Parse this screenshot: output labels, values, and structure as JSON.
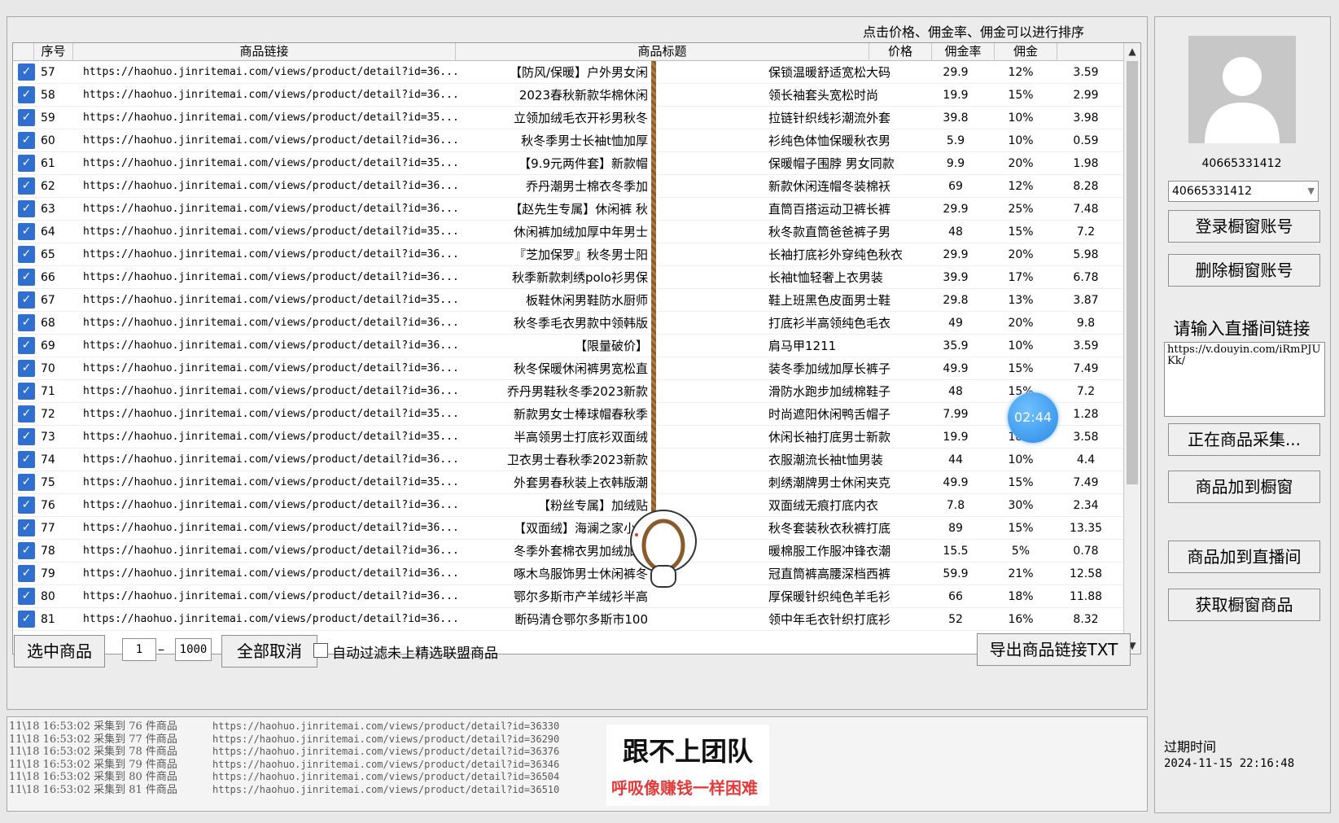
{
  "hint": "点击价格、佣金率、佣金可以进行排序",
  "columns": {
    "index": "序号",
    "link": "商品链接",
    "title": "商品标题",
    "price": "价格",
    "rate": "佣金率",
    "commission": "佣金"
  },
  "rows": [
    {
      "idx": "57",
      "link": "https://haohuo.jinritemai.com/views/product/detail?id=36...",
      "t1": "【防风/保暖】户外男女闲",
      "t2": "保锁温暖舒适宽松大码",
      "price": "29.9",
      "rate": "12%",
      "comm": "3.59"
    },
    {
      "idx": "58",
      "link": "https://haohuo.jinritemai.com/views/product/detail?id=36...",
      "t1": "2023春秋新款华棉休闲",
      "t2": "领长袖套头宽松时尚",
      "price": "19.9",
      "rate": "15%",
      "comm": "2.99"
    },
    {
      "idx": "59",
      "link": "https://haohuo.jinritemai.com/views/product/detail?id=35...",
      "t1": "立领加绒毛衣开衫男秋冬",
      "t2": "拉链针织线衫潮流外套",
      "price": "39.8",
      "rate": "10%",
      "comm": "3.98"
    },
    {
      "idx": "60",
      "link": "https://haohuo.jinritemai.com/views/product/detail?id=36...",
      "t1": "秋冬季男士长袖t恤加厚",
      "t2": "衫纯色体恤保暖秋衣男",
      "price": "5.9",
      "rate": "10%",
      "comm": "0.59"
    },
    {
      "idx": "61",
      "link": "https://haohuo.jinritemai.com/views/product/detail?id=35...",
      "t1": "【9.9元两件套】新款帽",
      "t2": "保暖帽子围脖 男女同款",
      "price": "9.9",
      "rate": "20%",
      "comm": "1.98"
    },
    {
      "idx": "62",
      "link": "https://haohuo.jinritemai.com/views/product/detail?id=36...",
      "t1": "乔丹潮男士棉衣冬季加",
      "t2": "新款休闲连帽冬装棉袄",
      "price": "69",
      "rate": "12%",
      "comm": "8.28"
    },
    {
      "idx": "63",
      "link": "https://haohuo.jinritemai.com/views/product/detail?id=36...",
      "t1": "【赵先生专属】休闲裤 秋",
      "t2": "直筒百搭运动卫裤长裤",
      "price": "29.9",
      "rate": "25%",
      "comm": "7.48"
    },
    {
      "idx": "64",
      "link": "https://haohuo.jinritemai.com/views/product/detail?id=35...",
      "t1": "休闲裤加绒加厚中年男士",
      "t2": "秋冬款直筒爸爸裤子男",
      "price": "48",
      "rate": "15%",
      "comm": "7.2"
    },
    {
      "idx": "65",
      "link": "https://haohuo.jinritemai.com/views/product/detail?id=36...",
      "t1": "『芝加保罗』秋冬男士阳",
      "t2": "长袖打底衫外穿纯色秋衣",
      "price": "29.9",
      "rate": "20%",
      "comm": "5.98"
    },
    {
      "idx": "66",
      "link": "https://haohuo.jinritemai.com/views/product/detail?id=36...",
      "t1": "秋季新款刺绣polo衫男保",
      "t2": "长袖t恤轻奢上衣男装",
      "price": "39.9",
      "rate": "17%",
      "comm": "6.78"
    },
    {
      "idx": "67",
      "link": "https://haohuo.jinritemai.com/views/product/detail?id=35...",
      "t1": "板鞋休闲男鞋防水厨师",
      "t2": "鞋上班黑色皮面男士鞋",
      "price": "29.8",
      "rate": "13%",
      "comm": "3.87"
    },
    {
      "idx": "68",
      "link": "https://haohuo.jinritemai.com/views/product/detail?id=36...",
      "t1": "秋冬季毛衣男款中领韩版",
      "t2": "打底衫半高领纯色毛衣",
      "price": "49",
      "rate": "20%",
      "comm": "9.8"
    },
    {
      "idx": "69",
      "link": "https://haohuo.jinritemai.com/views/product/detail?id=36...",
      "t1": "【限量破价】",
      "t2": "肩马甲1211",
      "price": "35.9",
      "rate": "10%",
      "comm": "3.59"
    },
    {
      "idx": "70",
      "link": "https://haohuo.jinritemai.com/views/product/detail?id=36...",
      "t1": "秋冬保暖休闲裤男宽松直",
      "t2": "装冬季加绒加厚长裤子",
      "price": "49.9",
      "rate": "15%",
      "comm": "7.49"
    },
    {
      "idx": "71",
      "link": "https://haohuo.jinritemai.com/views/product/detail?id=36...",
      "t1": "乔丹男鞋秋冬季2023新款",
      "t2": "滑防水跑步加绒棉鞋子",
      "price": "48",
      "rate": "15%",
      "comm": "7.2"
    },
    {
      "idx": "72",
      "link": "https://haohuo.jinritemai.com/views/product/detail?id=35...",
      "t1": "新款男女士棒球帽春秋季",
      "t2": "时尚遮阳休闲鸭舌帽子",
      "price": "7.99",
      "rate": "16%",
      "comm": "1.28"
    },
    {
      "idx": "73",
      "link": "https://haohuo.jinritemai.com/views/product/detail?id=35...",
      "t1": "半高领男士打底衫双面绒",
      "t2": "休闲长袖打底男士新款",
      "price": "19.9",
      "rate": "18%",
      "comm": "3.58"
    },
    {
      "idx": "74",
      "link": "https://haohuo.jinritemai.com/views/product/detail?id=36...",
      "t1": "卫衣男士春秋季2023新款",
      "t2": "衣服潮流长袖t恤男装",
      "price": "44",
      "rate": "10%",
      "comm": "4.4"
    },
    {
      "idx": "75",
      "link": "https://haohuo.jinritemai.com/views/product/detail?id=35...",
      "t1": "外套男春秋装上衣韩版潮",
      "t2": "刺绣潮牌男士休闲夹克",
      "price": "49.9",
      "rate": "15%",
      "comm": "7.49"
    },
    {
      "idx": "76",
      "link": "https://haohuo.jinritemai.com/views/product/detail?id=36...",
      "t1": "【粉丝专属】加绒贴",
      "t2": "双面绒无痕打底内衣",
      "price": "7.8",
      "rate": "30%",
      "comm": "2.34"
    },
    {
      "idx": "77",
      "link": "https://haohuo.jinritemai.com/views/product/detail?id=36...",
      "t1": "【双面绒】海澜之家小火",
      "t2": "秋冬套装秋衣秋裤打底",
      "price": "89",
      "rate": "15%",
      "comm": "13.35"
    },
    {
      "idx": "78",
      "link": "https://haohuo.jinritemai.com/views/product/detail?id=36...",
      "t1": "冬季外套棉衣男加绒加厚",
      "t2": "暖棉服工作服冲锋衣潮",
      "price": "15.5",
      "rate": "5%",
      "comm": "0.78"
    },
    {
      "idx": "79",
      "link": "https://haohuo.jinritemai.com/views/product/detail?id=36...",
      "t1": "啄木鸟服饰男士休闲裤冬",
      "t2": "冠直筒裤高腰深档西裤",
      "price": "59.9",
      "rate": "21%",
      "comm": "12.58"
    },
    {
      "idx": "80",
      "link": "https://haohuo.jinritemai.com/views/product/detail?id=36...",
      "t1": "鄂尔多斯市产羊绒衫半高",
      "t2": "厚保暖针织纯色羊毛衫",
      "price": "66",
      "rate": "18%",
      "comm": "11.88"
    },
    {
      "idx": "81",
      "link": "https://haohuo.jinritemai.com/views/product/detail?id=36...",
      "t1": "断码清仓鄂尔多斯市100",
      "t2": "领中年毛衣针织打底衫",
      "price": "52",
      "rate": "16%",
      "comm": "8.32"
    }
  ],
  "controls": {
    "select_products": "选中商品",
    "range_from": "1",
    "range_to": "1000",
    "range_sep": "–",
    "cancel_all": "全部取消",
    "auto_filter": "自动过滤未上精选联盟商品",
    "export_txt": "导出商品链接TXT"
  },
  "log": [
    {
      "text": "11\\18 16:53:02 采集到 76 件商品",
      "url": "https://haohuo.jinritemai.com/views/product/detail?id=36330"
    },
    {
      "text": "11\\18 16:53:02 采集到 77 件商品",
      "url": "https://haohuo.jinritemai.com/views/product/detail?id=36290"
    },
    {
      "text": "11\\18 16:53:02 采集到 78 件商品",
      "url": "https://haohuo.jinritemai.com/views/product/detail?id=36376"
    },
    {
      "text": "11\\18 16:53:02 采集到 79 件商品",
      "url": "https://haohuo.jinritemai.com/views/product/detail?id=36346"
    },
    {
      "text": "11\\18 16:53:02 采集到 80 件商品",
      "url": "https://haohuo.jinritemai.com/views/product/detail?id=36504"
    },
    {
      "text": "11\\18 16:53:02 采集到 81 件商品",
      "url": "https://haohuo.jinritemai.com/views/product/detail?id=36510"
    }
  ],
  "overlay": {
    "line1": "跟不上团队",
    "line2": "呼吸像赚钱一样困难",
    "timer": "02:44",
    "line2_color": "#e53a3a"
  },
  "right": {
    "account_id": "40665331412",
    "account_select": "40665331412",
    "login_btn": "登录橱窗账号",
    "delete_btn": "删除橱窗账号",
    "live_label": "请输入直播间链接",
    "live_url": "https://v.douyin.com/iRmPJUKk/",
    "collecting_btn": "正在商品采集...",
    "add_window_btn": "商品加到橱窗",
    "add_live_btn": "商品加到直播间",
    "get_window_btn": "获取橱窗商品",
    "expire_label": "过期时间",
    "expire_value": "2024-11-15 22:16:48"
  },
  "colors": {
    "checkbox": "#2f6fd0",
    "timer": "#2b8be6"
  }
}
